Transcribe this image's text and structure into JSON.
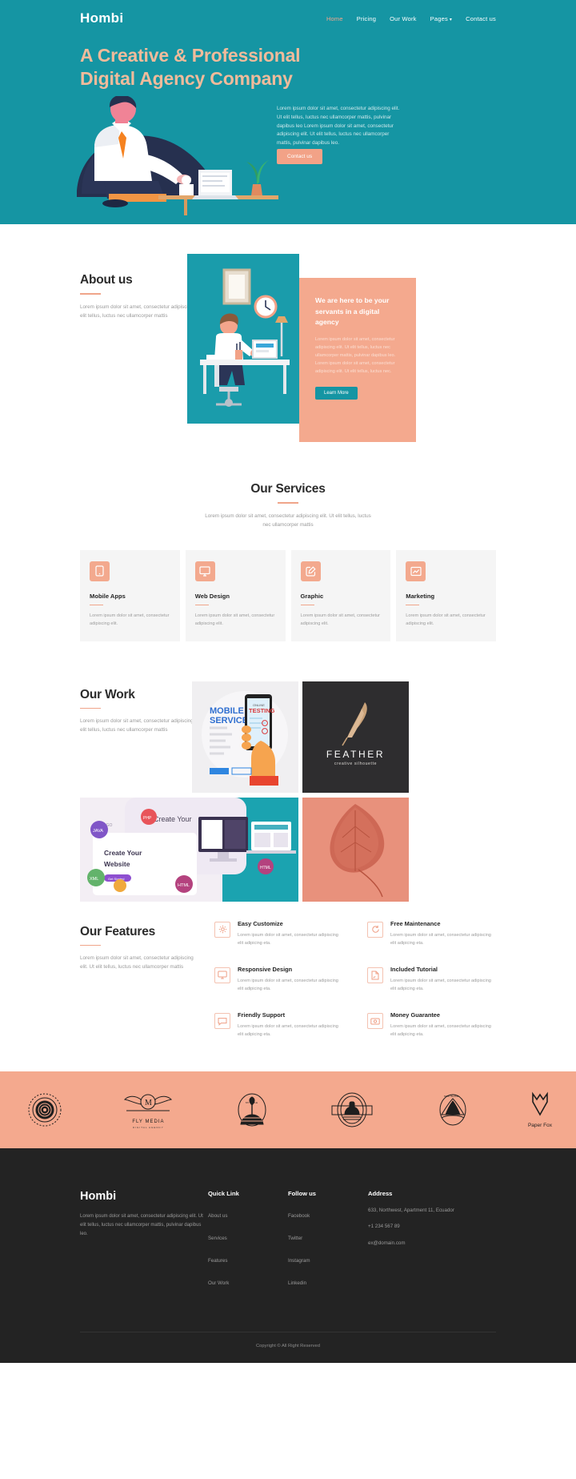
{
  "colors": {
    "teal": "#1595a3",
    "salmon": "#f4a98e",
    "hero_heading": "#f0bb9b",
    "dark": "#232323"
  },
  "nav": {
    "brand": "Hombi",
    "items": [
      {
        "label": "Home",
        "active": true
      },
      {
        "label": "Pricing",
        "active": false
      },
      {
        "label": "Our Work",
        "active": false
      },
      {
        "label": "Pages",
        "active": false,
        "caret": "▾"
      },
      {
        "label": "Contact us",
        "active": false
      }
    ]
  },
  "hero": {
    "title_line1": "A Creative & Professional",
    "title_line2": "Digital Agency Company",
    "paragraph": "Lorem ipsum dolor sit amet, consectetur adipiscing elit. Ut elit tellus, luctus nec ullamcorper mattis, pulvinar dapibus leo Lorem ipsum dolor sit amet, consectetur adipiscing elit. Ut elit tellus, luctus nec ullamcorper mattis, pulvinar dapibus leo.",
    "cta_label": "Contact us",
    "illustration": "businessman-at-desk-illustration"
  },
  "about": {
    "heading": "About us",
    "paragraph": "Lorem ipsum dolor sit amet, consectetur adipiscing elit. Ut elit tellus, luctus nec ullamcorper mattis",
    "image_alt": "man-working-at-desk-illustration",
    "card_heading": "We are here to be your servants in a digital agency",
    "card_paragraph": "Lorem ipsum dolor sit amet, consectetur adipiscing elit. Ut elit tellus, luctus nec ullamcorper mattis, pulvinar dapibus leo. Lorem ipsum dolor sit amet, consectetur adipiscing elit. Ut elit tellus, luctus nec.",
    "cta_label": "Learn More"
  },
  "services": {
    "heading": "Our Services",
    "subheading": "Lorem ipsum dolor sit amet, consectetur adipiscing elit. Ut elit tellus, luctus nec ullamcorper mattis",
    "cards": [
      {
        "icon": "mobile-phone-icon",
        "title": "Mobile Apps",
        "text": "Lorem ipsum dolor sit amet, consectetur adipiscing elit."
      },
      {
        "icon": "monitor-icon",
        "title": "Web Design",
        "text": "Lorem ipsum dolor sit amet, consectetur adipiscing elit."
      },
      {
        "icon": "pen-edit-icon",
        "title": "Graphic",
        "text": "Lorem ipsum dolor sit amet, consectetur adipiscing elit."
      },
      {
        "icon": "chart-growth-icon",
        "title": "Marketing",
        "text": "Lorem ipsum dolor sit amet, consectetur adipiscing elit."
      }
    ]
  },
  "work": {
    "heading": "Our Work",
    "paragraph": "Lorem ipsum dolor sit amet, consectetur adipiscing elit. Ut elit tellus, luctus nec ullamcorper mattis",
    "tiles": [
      {
        "name": "mobile-service-testing",
        "label_line1": "MOBILE",
        "label_line2": "SERVICE",
        "badge_line1": "ONLINE",
        "badge_line2": "TESTING"
      },
      {
        "name": "feather-logo-dark",
        "title": "FEATHER",
        "subtitle": "creative silhouette"
      },
      {
        "name": "create-your-website",
        "label_line1": "Create Your",
        "label_line2": "Website",
        "small_label": "LOGO",
        "chip": "Get Started"
      },
      {
        "name": "autumn-leaf-photo"
      }
    ]
  },
  "features": {
    "heading": "Our Features",
    "paragraph": "Lorem ipsum dolor sit amet, consectetur adipiscing elit. Ut elit tellus, luctus nec ullamcorper mattis",
    "items": [
      {
        "icon": "gear-icon",
        "title": "Easy Customize",
        "text": "Lorem ipsum dolor sit amet, consectetur adipiscing elit adipicing eta."
      },
      {
        "icon": "refresh-icon",
        "title": "Free Maintenance",
        "text": "Lorem ipsum dolor sit amet, consectetur adipiscing elit adipicing eta."
      },
      {
        "icon": "monitor-icon",
        "title": "Responsive Design",
        "text": "Lorem ipsum dolor sit amet, consectetur adipiscing elit adipicing eta."
      },
      {
        "icon": "document-icon",
        "title": "Included Tutorial",
        "text": "Lorem ipsum dolor sit amet, consectetur adipiscing elit adipicing eta."
      },
      {
        "icon": "chat-bubble-icon",
        "title": "Friendly Support",
        "text": "Lorem ipsum dolor sit amet, consectetur adipiscing elit adipicing eta."
      },
      {
        "icon": "money-badge-icon",
        "title": "Money Guarantee",
        "text": "Lorem ipsum dolor sit amet, consectetur adipiscing elit adipicing eta."
      }
    ]
  },
  "clients": [
    {
      "name": "the-flower-boutique-badge-logo",
      "label": ""
    },
    {
      "name": "fly-media-wings-logo",
      "label": "FLY MEDIA",
      "sub": "DIGITAL AGENCY"
    },
    {
      "name": "my-little-bee-badge-logo",
      "label": ""
    },
    {
      "name": "oval-emblem-logo",
      "label": ""
    },
    {
      "name": "new-island-travel-badge-logo",
      "label": ""
    },
    {
      "name": "paper-fox-logo",
      "label": "Paper Fox"
    }
  ],
  "footer": {
    "brand": "Hombi",
    "description": "Lorem ipsum dolor sit amet, consectetur adipiscing elit. Ut elit tellus, luctus nec ullamcorper mattis, pulvinar dapibus leo.",
    "quick_link": {
      "title": "Quick Link",
      "items": [
        "About us",
        "Services",
        "Features",
        "Our Work"
      ]
    },
    "follow_us": {
      "title": "Follow us",
      "items": [
        "Facebook",
        "Twitter",
        "Instagram",
        "Linkedin"
      ]
    },
    "address": {
      "title": "Address",
      "street": "633, Northwest, Apartment 11, Ecuador",
      "phone": "+1 234 567 89",
      "email": "ex@domain.com"
    },
    "copyright": "Copyright © All Right Reserved"
  }
}
